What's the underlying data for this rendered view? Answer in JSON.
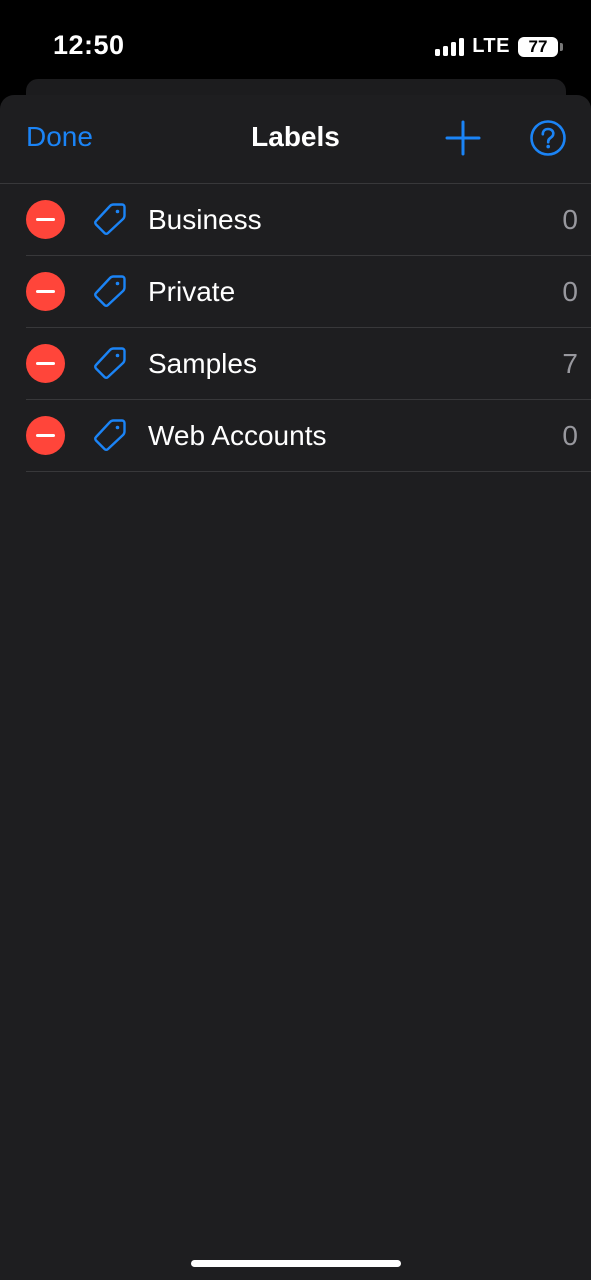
{
  "status_bar": {
    "time": "12:50",
    "network": "LTE",
    "battery": "77",
    "icons": [
      "signal-icon",
      "battery-icon"
    ]
  },
  "nav": {
    "done_label": "Done",
    "title": "Labels",
    "add_icon": "plus-icon",
    "help_icon": "question-circle-icon"
  },
  "labels": [
    {
      "name": "Business",
      "count": "0",
      "icon": "tag-icon"
    },
    {
      "name": "Private",
      "count": "0",
      "icon": "tag-icon"
    },
    {
      "name": "Samples",
      "count": "7",
      "icon": "tag-icon"
    },
    {
      "name": "Web Accounts",
      "count": "0",
      "icon": "tag-icon"
    }
  ],
  "colors": {
    "accent": "#1b84f6",
    "delete": "#ff453a",
    "background": "#1e1e20",
    "separator": "#38383a",
    "count_text": "#98989e"
  }
}
